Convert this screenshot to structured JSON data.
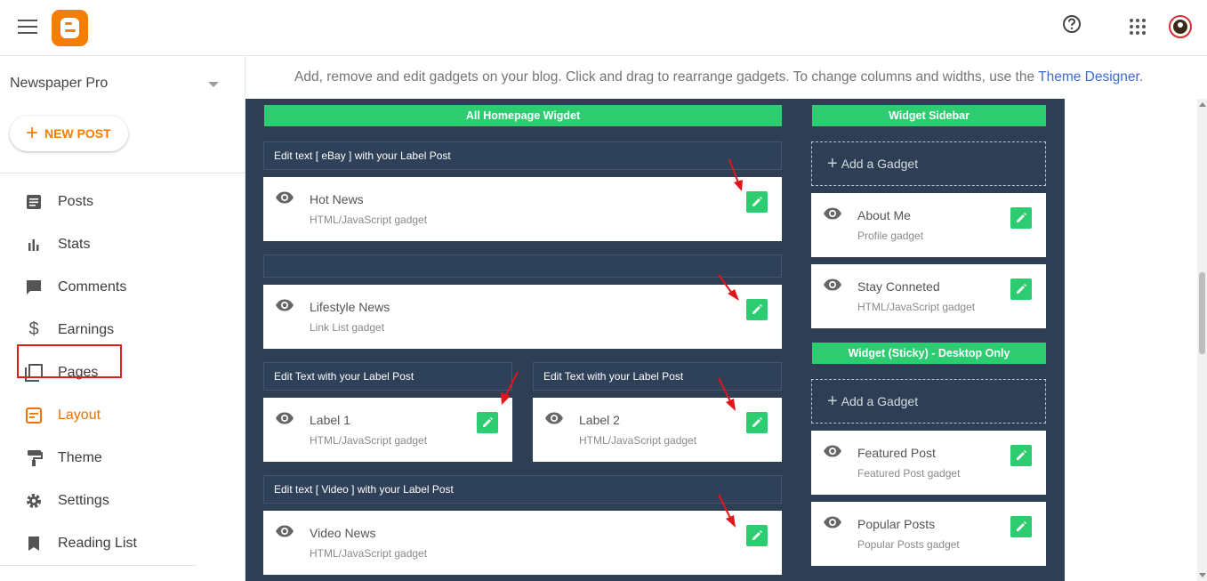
{
  "header": {
    "menu_icon": "hamburger-icon",
    "logo": "blogger-logo",
    "help_icon": "help-circle-icon",
    "apps_icon": "apps-grid-icon",
    "avatar": "user-avatar"
  },
  "sidebar": {
    "blog_name": "Newspaper Pro",
    "new_post_label": "NEW POST",
    "items": [
      {
        "label": "Posts",
        "icon": "posts-icon"
      },
      {
        "label": "Stats",
        "icon": "stats-icon"
      },
      {
        "label": "Comments",
        "icon": "comments-icon"
      },
      {
        "label": "Earnings",
        "icon": "dollar-icon"
      },
      {
        "label": "Pages",
        "icon": "pages-icon"
      },
      {
        "label": "Layout",
        "icon": "layout-icon",
        "active": true
      },
      {
        "label": "Theme",
        "icon": "paint-roller-icon"
      },
      {
        "label": "Settings",
        "icon": "gear-icon"
      },
      {
        "label": "Reading List",
        "icon": "bookmark-icon"
      }
    ]
  },
  "main": {
    "info_text": "Add, remove and edit gadgets on your blog. Click and drag to rearrange gadgets. To change columns and widths, use the",
    "info_link": "Theme Designer",
    "info_end": ".",
    "left_column": {
      "title": "All Homepage Wigdet",
      "section1_head": "Edit text [ eBay ] with your Label Post",
      "gadget1": {
        "title": "Hot News",
        "sub": "HTML/JavaScript gadget"
      },
      "gadget2": {
        "title": "Lifestyle News",
        "sub": "Link List gadget"
      },
      "section3_left_head": "Edit Text with your Label Post",
      "section3_right_head": "Edit Text with your Label Post",
      "gadget3": {
        "title": "Label 1",
        "sub": "HTML/JavaScript gadget"
      },
      "gadget4": {
        "title": "Label 2",
        "sub": "HTML/JavaScript gadget"
      },
      "section4_head": "Edit text [ Video ] with your Label Post",
      "gadget5": {
        "title": "Video News",
        "sub": "HTML/JavaScript gadget"
      }
    },
    "right_column": {
      "sidebar_title": "Widget Sidebar",
      "add_gadget_1": "Add a Gadget",
      "gadget1": {
        "title": "About Me",
        "sub": "Profile gadget"
      },
      "gadget2": {
        "title": "Stay Conneted",
        "sub": "HTML/JavaScript gadget"
      },
      "sticky_title": "Widget (Sticky) - Desktop Only",
      "add_gadget_2": "Add a Gadget",
      "gadget3": {
        "title": "Featured Post",
        "sub": "Featured Post gadget"
      },
      "gadget4": {
        "title": "Popular Posts",
        "sub": "Popular Posts gadget"
      }
    }
  },
  "colors": {
    "accent": "#f57d00",
    "green": "#2ecc71",
    "canvas": "#2e3f55",
    "highlight_border": "#d9201f",
    "arrow": "#e0161c"
  }
}
